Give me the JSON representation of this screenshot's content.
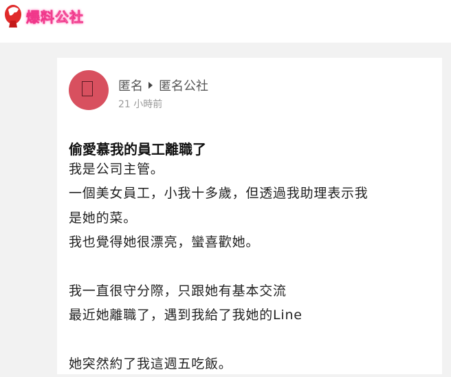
{
  "header": {
    "logo_text": "爆料公社"
  },
  "post": {
    "author": "匿名",
    "board": "匿名公社",
    "time": "21 小時前",
    "title": "偷愛慕我的員工離職了",
    "lines": [
      "我是公司主管。",
      "一個美女員工，小我十多歲，但透過我助理表示我",
      "是她的菜。",
      "我也覺得她很漂亮，蠻喜歡她。",
      "",
      "我一直很守分際，只跟她有基本交流",
      "最近她離職了，遇到我給了我她的Line",
      "",
      "她突然約了我這週五吃飯。"
    ]
  },
  "colors": {
    "avatar": "#d8505f",
    "logo_pink": "#f0378a"
  }
}
